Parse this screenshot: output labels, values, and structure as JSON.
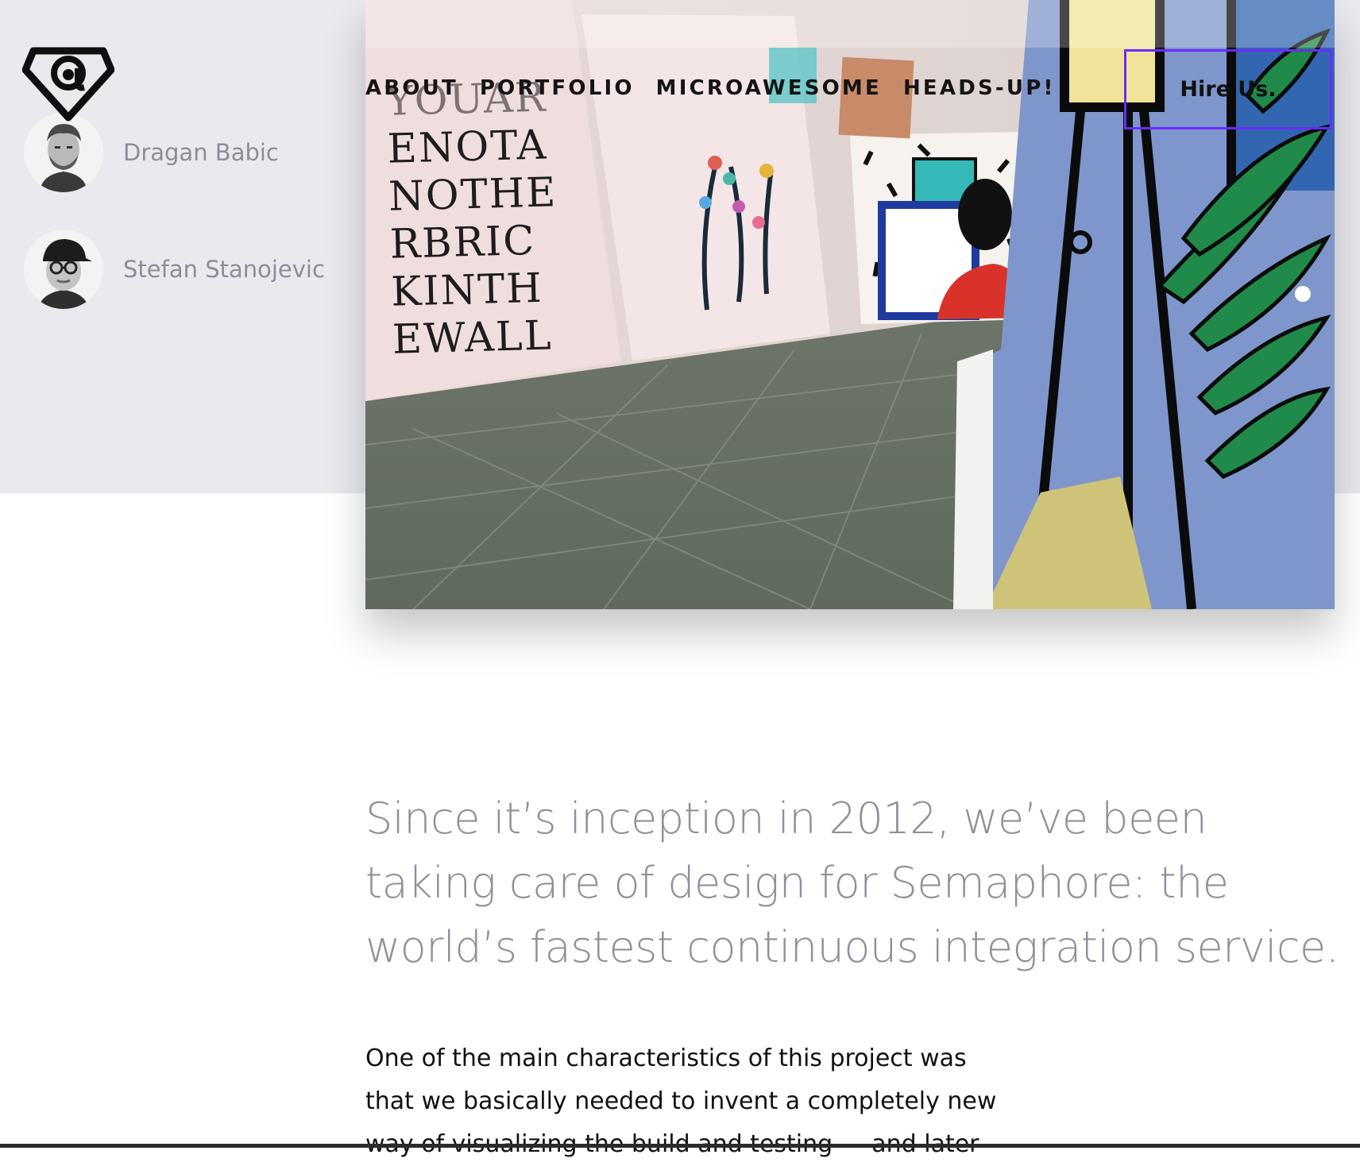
{
  "nav": {
    "items": [
      {
        "label": "ABOUT"
      },
      {
        "label": "PORTFOLIO"
      },
      {
        "label": "MICROAWESOME"
      },
      {
        "label": "HEADS-UP!"
      }
    ],
    "cta_label": "Hire Us.",
    "cta_border_color": "#6b2bff"
  },
  "logo": {
    "icon": "at-diamond-logo-icon"
  },
  "team": [
    {
      "name": "Dragan Babic"
    },
    {
      "name": "Stefan Stanojevic"
    }
  ],
  "hero": {
    "poster_lines": [
      "YOUAR",
      "ENOTA",
      "NOTHE",
      "RBRIC",
      "KINTH",
      "EWALL"
    ]
  },
  "content": {
    "lead": "Since it’s inception in 2012, we’ve been taking care of design for Semaphore: the world’s fastest continuous integration service.",
    "body": "One of the main characteristics of this project was that we basically needed to invent a completely new way of visualizing the build and testing — and later"
  },
  "colors": {
    "band": "#e9e9ee",
    "lead_text": "#8f8f9b",
    "name_text": "#8d8d99"
  }
}
